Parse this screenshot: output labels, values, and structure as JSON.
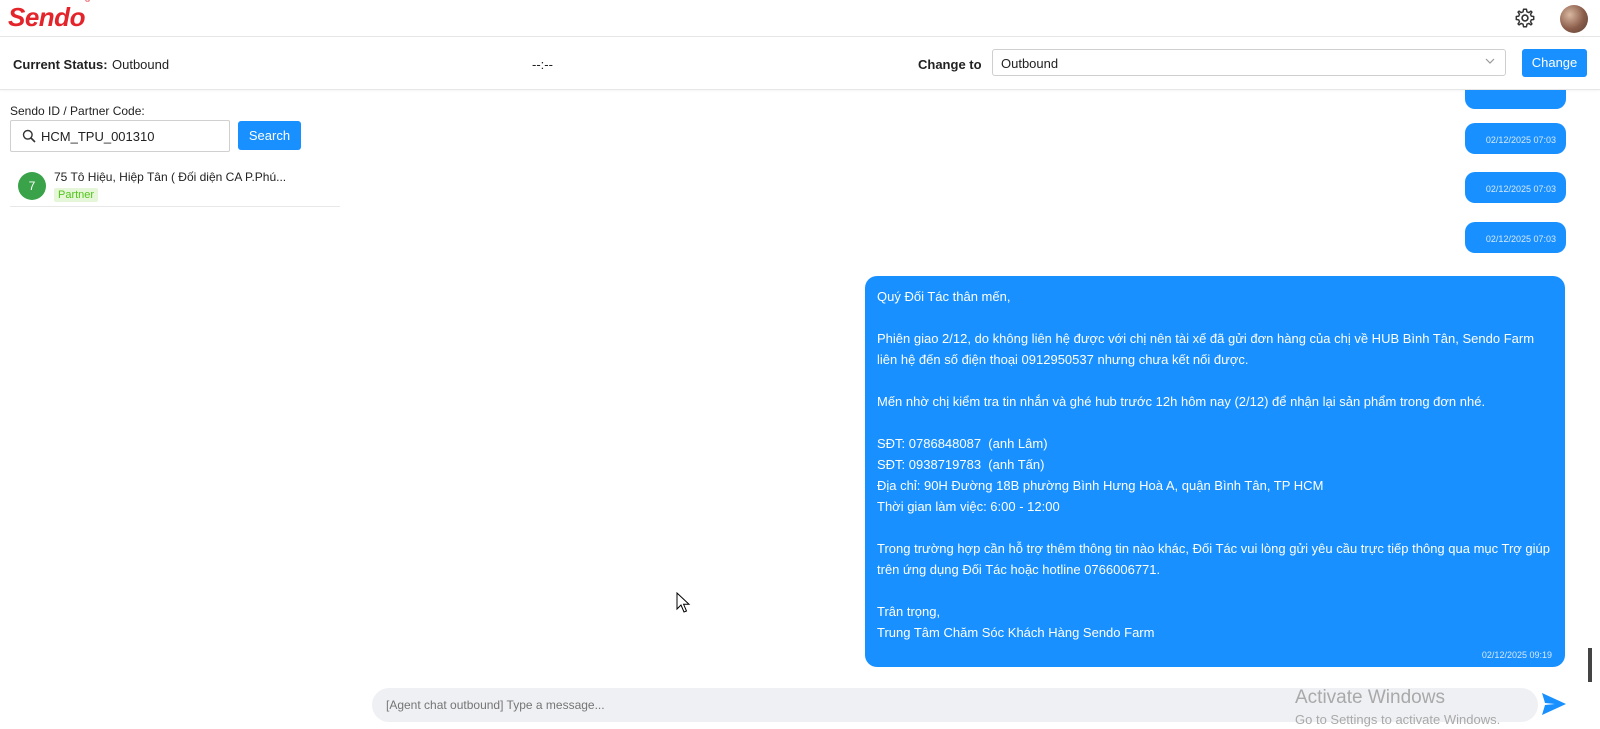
{
  "brand": {
    "logo_text": "Sendo",
    "logo_mark": "®",
    "logo_color": "#e3242b"
  },
  "header": {
    "settings_icon": "gear-icon",
    "avatar_icon": "user-avatar"
  },
  "status_bar": {
    "current_status_label": "Current Status:",
    "current_status_value": "Outbound",
    "timer": "--:--",
    "change_to_label": "Change to",
    "change_to_selected": "Outbound",
    "change_button": "Change"
  },
  "search": {
    "label": "Sendo ID / Partner Code:",
    "value": "HCM_TPU_001310",
    "button": "Search"
  },
  "contacts": [
    {
      "badge": "7",
      "name": "75 Tô Hiệu, Hiệp Tân ( Đối diện CA P.Phú...",
      "tag": "Partner"
    }
  ],
  "chat": {
    "timestamps": [
      "02/12/2025 07:03",
      "02/12/2025 07:03",
      "02/12/2025 07:03"
    ],
    "message": {
      "body": "Quý Đối Tác thân mến,\n\nPhiên giao 2/12, do không liên hệ được với chị nên tài xế đã gửi đơn hàng của chị về HUB Bình Tân, Sendo Farm liên hệ đến số điện thoại 0912950537 nhưng chưa kết nối được.\n\nMến nhờ chị kiểm tra tin nhắn và ghé hub trước 12h hôm nay (2/12) để nhận lại sản phẩm trong đơn nhé.\n\nSĐT: 0786848087  (anh Lâm)\nSĐT: 0938719783  (anh Tấn)\nĐịa chỉ: 90H Đường 18B phường Bình Hưng Hoà A, quận Bình Tân, TP HCM\nThời gian làm việc: 6:00 - 12:00\n\nTrong trường hợp cần hỗ trợ thêm thông tin nào khác, Đối Tác vui lòng gửi yêu cầu trực tiếp thông qua mục Trợ giúp trên ứng dụng Đối Tác hoặc hotline 0766006771.\n\nTrân trọng,\nTrung Tâm Chăm Sóc Khách Hàng Sendo Farm",
      "time": "02/12/2025 09:19"
    },
    "composer_placeholder": "[Agent chat outbound] Type a message...",
    "send_icon": "send-icon"
  },
  "watermark": {
    "line1": "Activate Windows",
    "line2": "Go to Settings to activate Windows."
  },
  "colors": {
    "primary": "#1890ff",
    "partner_green": "#3aa34a"
  }
}
